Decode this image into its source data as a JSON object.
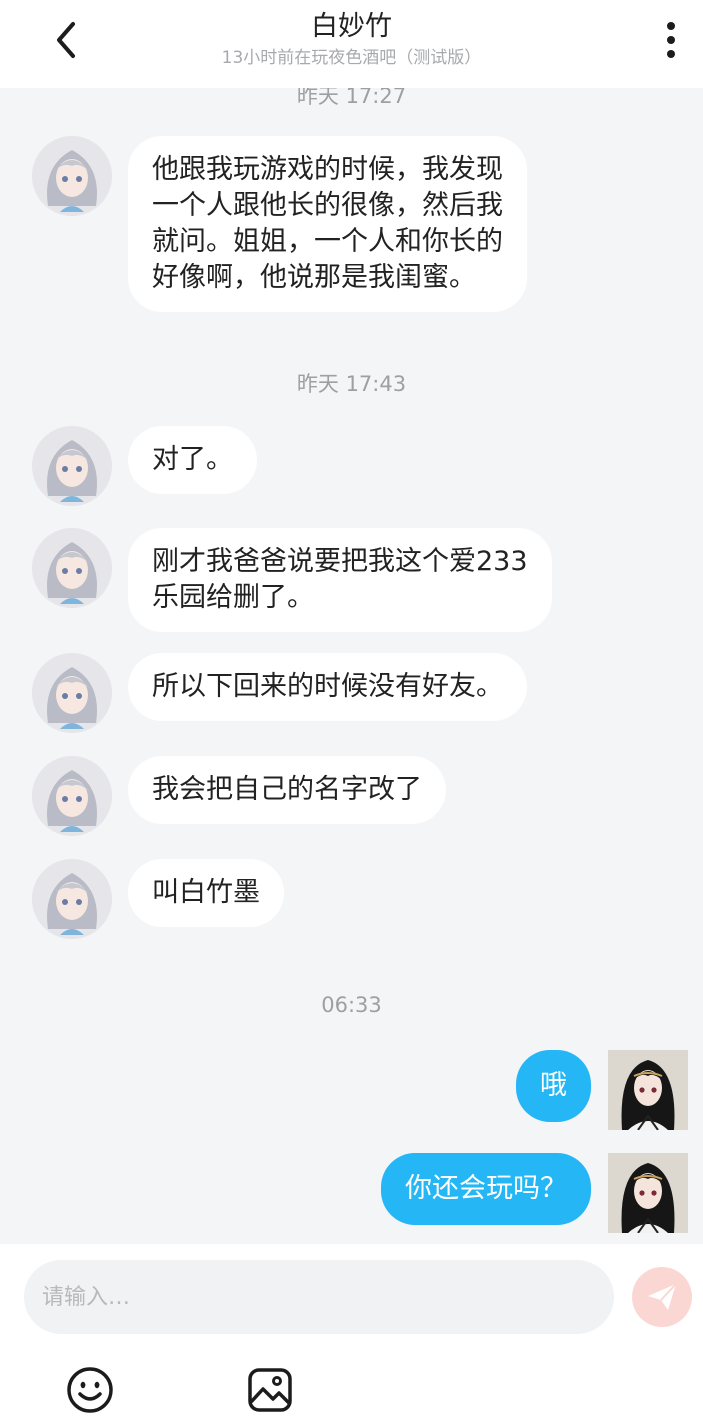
{
  "header": {
    "back_icon": "chevron-left-icon",
    "title": "白妙竹",
    "subtitle": "13小时前在玩夜色酒吧（测试版）",
    "more_icon": "more-vertical-icon"
  },
  "messages": {
    "time1": "昨天  17:27",
    "msg1": "他跟我玩游戏的时候，我发现\n一个人跟他长的很像，然后我\n就问。姐姐，一个人和你长的\n好像啊，他说那是我闺蜜。",
    "time2": "昨天  17:43",
    "msg2": "对了。",
    "msg3": "刚才我爸爸说要把我这个爱233\n乐园给删了。",
    "msg4": "所以下回来的时候没有好友。",
    "msg5": "我会把自己的名字改了",
    "msg6": "叫白竹墨",
    "time3": "06:33",
    "msg7": "哦",
    "msg8": "你还会玩吗？"
  },
  "input": {
    "placeholder": "请输入…",
    "send_icon": "send-icon",
    "emoji_icon": "emoji-icon",
    "image_icon": "image-icon"
  },
  "colors": {
    "accent": "#25b6f5",
    "background": "#f4f5f7",
    "send_button": "#fbd7d3"
  }
}
